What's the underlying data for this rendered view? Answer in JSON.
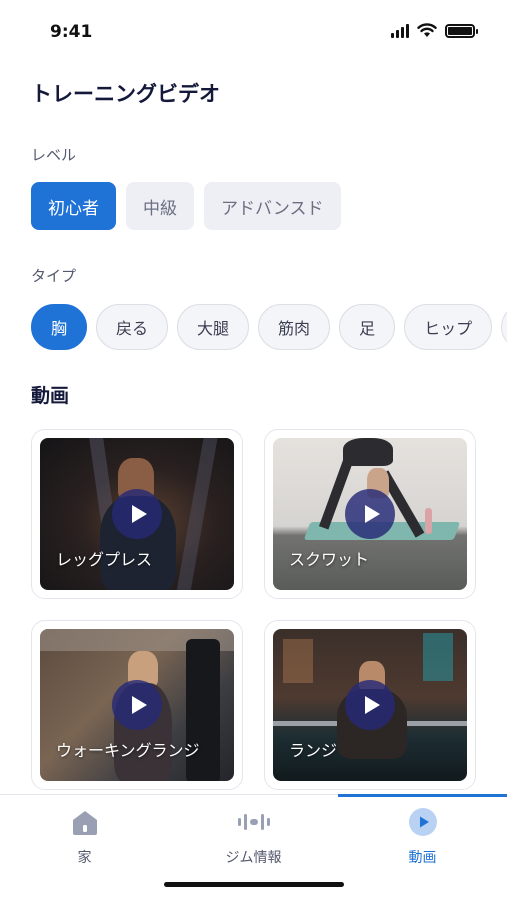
{
  "status_bar": {
    "time": "9:41"
  },
  "page": {
    "title": "トレーニングビデオ"
  },
  "level": {
    "label": "レベル",
    "options": [
      "初心者",
      "中級",
      "アドバンスド"
    ],
    "selected": "初心者"
  },
  "type": {
    "label": "タイプ",
    "options": [
      "胸",
      "戻る",
      "大腿",
      "筋肉",
      "足",
      "ヒップ",
      "ヒ"
    ],
    "selected": "胸"
  },
  "videos": {
    "title": "動画",
    "items": [
      {
        "label": "レッグプレス",
        "icon": "play-icon"
      },
      {
        "label": "スクワット",
        "icon": "play-icon"
      },
      {
        "label": "ウォーキングランジ",
        "icon": "play-icon"
      },
      {
        "label": "ランジ",
        "icon": "play-icon"
      }
    ]
  },
  "bottom_nav": {
    "items": [
      {
        "label": "家",
        "icon": "home-icon"
      },
      {
        "label": "ジム情報",
        "icon": "equalizer-icon"
      },
      {
        "label": "動画",
        "icon": "video-play-icon"
      }
    ],
    "active": "動画"
  },
  "colors": {
    "accent": "#1f72d6",
    "chip_inactive": "#eeeff4",
    "text_dark": "#14183a",
    "text_muted": "#55596e"
  }
}
